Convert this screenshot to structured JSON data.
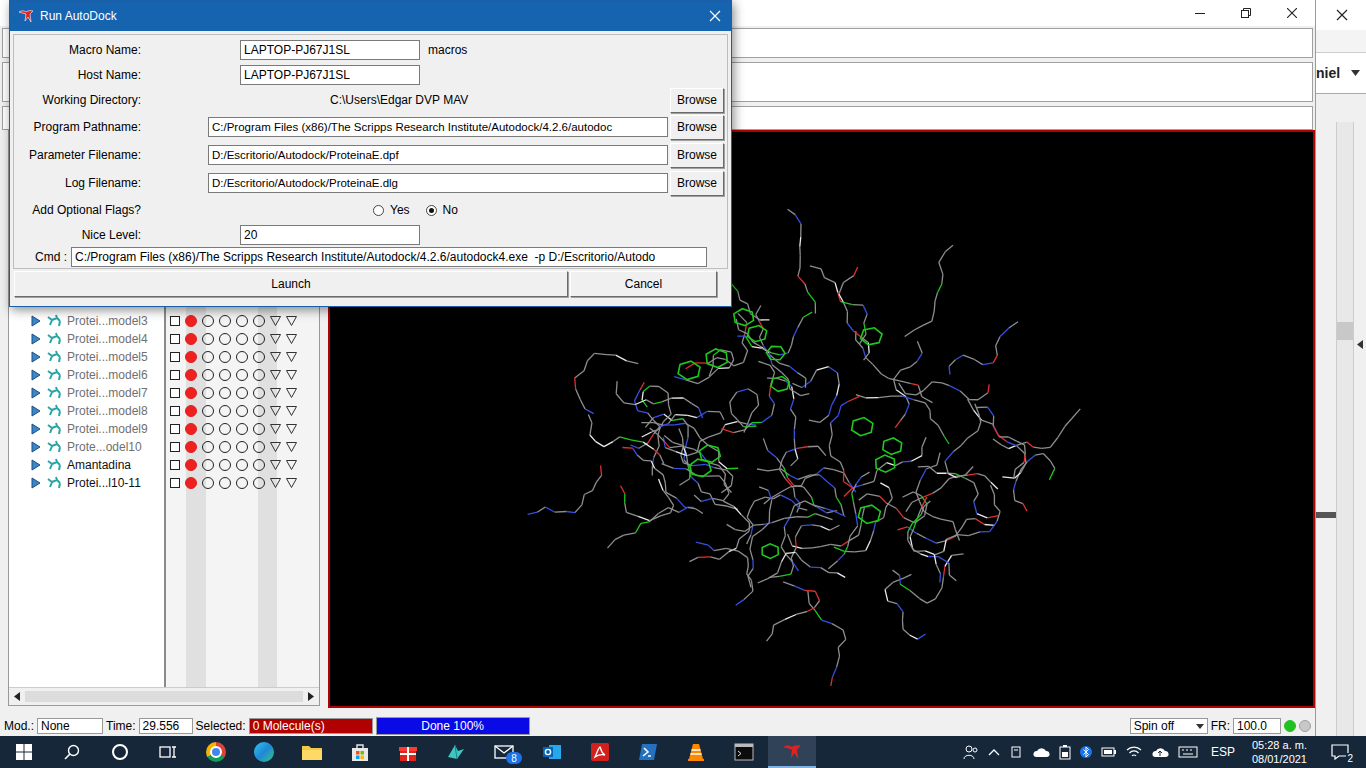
{
  "dialog": {
    "title": "Run AutoDock",
    "macro": {
      "label": "Macro Name:",
      "value": "LAPTOP-PJ67J1SL",
      "suffix": "macros"
    },
    "host": {
      "label": "Host Name:",
      "value": "LAPTOP-PJ67J1SL"
    },
    "working_directory": {
      "label": "Working Directory:",
      "value": "C:\\Users\\Edgar DVP MAV",
      "button": "Browse"
    },
    "files": [
      {
        "label": "Program Pathname:",
        "value": "C:/Program Files (x86)/The Scripps Research Institute/Autodock/4.2.6/autodoc",
        "button": "Browse"
      },
      {
        "label": "Parameter Filename:",
        "value": "D:/Escritorio/Autodock/ProteinaE.dpf",
        "button": "Browse"
      },
      {
        "label": "Log Filename:",
        "value": "D:/Escritorio/Autodock/ProteinaE.dlg",
        "button": "Browse"
      }
    ],
    "optional_flags": {
      "label": "Add Optional Flags?",
      "options": [
        {
          "label": "Yes",
          "selected": false
        },
        {
          "label": "No",
          "selected": true
        }
      ]
    },
    "nice_level": {
      "label": "Nice Level:",
      "value": "20"
    },
    "cmd": {
      "label": "Cmd :",
      "value": "C:/Program Files (x86)/The Scripps Research Institute/Autodock/4.2.6/autodock4.exe  -p D:/Escritorio/Autodo"
    },
    "buttons": [
      "Launch",
      "Cancel"
    ]
  },
  "side_window": {
    "label": "niel"
  },
  "molecules": [
    {
      "name": "Protei...model3",
      "greyed": true,
      "checked": false,
      "shown": true,
      "circles": [
        false,
        false,
        false,
        false
      ],
      "triangles": [
        false,
        false
      ]
    },
    {
      "name": "Protei...model4",
      "greyed": true,
      "checked": false,
      "shown": true,
      "circles": [
        false,
        false,
        false,
        false
      ],
      "triangles": [
        false,
        false
      ]
    },
    {
      "name": "Protei...model5",
      "greyed": true,
      "checked": false,
      "shown": true,
      "circles": [
        false,
        false,
        false,
        false
      ],
      "triangles": [
        false,
        false
      ]
    },
    {
      "name": "Protei...model6",
      "greyed": true,
      "checked": false,
      "shown": true,
      "circles": [
        false,
        false,
        false,
        false
      ],
      "triangles": [
        false,
        false
      ]
    },
    {
      "name": "Protei...model7",
      "greyed": true,
      "checked": false,
      "shown": true,
      "circles": [
        false,
        false,
        false,
        false
      ],
      "triangles": [
        false,
        false
      ]
    },
    {
      "name": "Protei...model8",
      "greyed": true,
      "checked": false,
      "shown": true,
      "circles": [
        false,
        false,
        false,
        false
      ],
      "triangles": [
        false,
        false
      ]
    },
    {
      "name": "Protei...model9",
      "greyed": true,
      "checked": false,
      "shown": true,
      "circles": [
        false,
        false,
        false,
        false
      ],
      "triangles": [
        false,
        false
      ]
    },
    {
      "name": "Prote...odel10",
      "greyed": true,
      "checked": false,
      "shown": true,
      "circles": [
        false,
        false,
        false,
        false
      ],
      "triangles": [
        false,
        false
      ]
    },
    {
      "name": "Amantadina",
      "greyed": false,
      "checked": false,
      "shown": true,
      "circles": [
        false,
        false,
        false,
        false
      ],
      "triangles": [
        false,
        false
      ]
    },
    {
      "name": "Protei...l10-11",
      "greyed": false,
      "checked": false,
      "shown": true,
      "circles": [
        false,
        false,
        false,
        false
      ],
      "triangles": [
        false,
        false
      ]
    }
  ],
  "status_bar": {
    "mod_label": "Mod.:",
    "mod": "None",
    "time_label": "Time:",
    "time": "29.556",
    "selected_label": "Selected:",
    "selected": "0 Molecule(s)",
    "progress_text": "Done 100%",
    "progress_level": 1,
    "spin": "Spin off",
    "fr_label": "FR:",
    "fr": "100.0",
    "lights": [
      {
        "on": true,
        "color": "#22c022"
      },
      {
        "on": false,
        "color": "#a0a0a0"
      }
    ]
  },
  "taskbar": {
    "mail_badge": "8",
    "language": "ESP",
    "time": "05:28 a. m.",
    "date": "08/01/2021",
    "notifications": "2"
  }
}
